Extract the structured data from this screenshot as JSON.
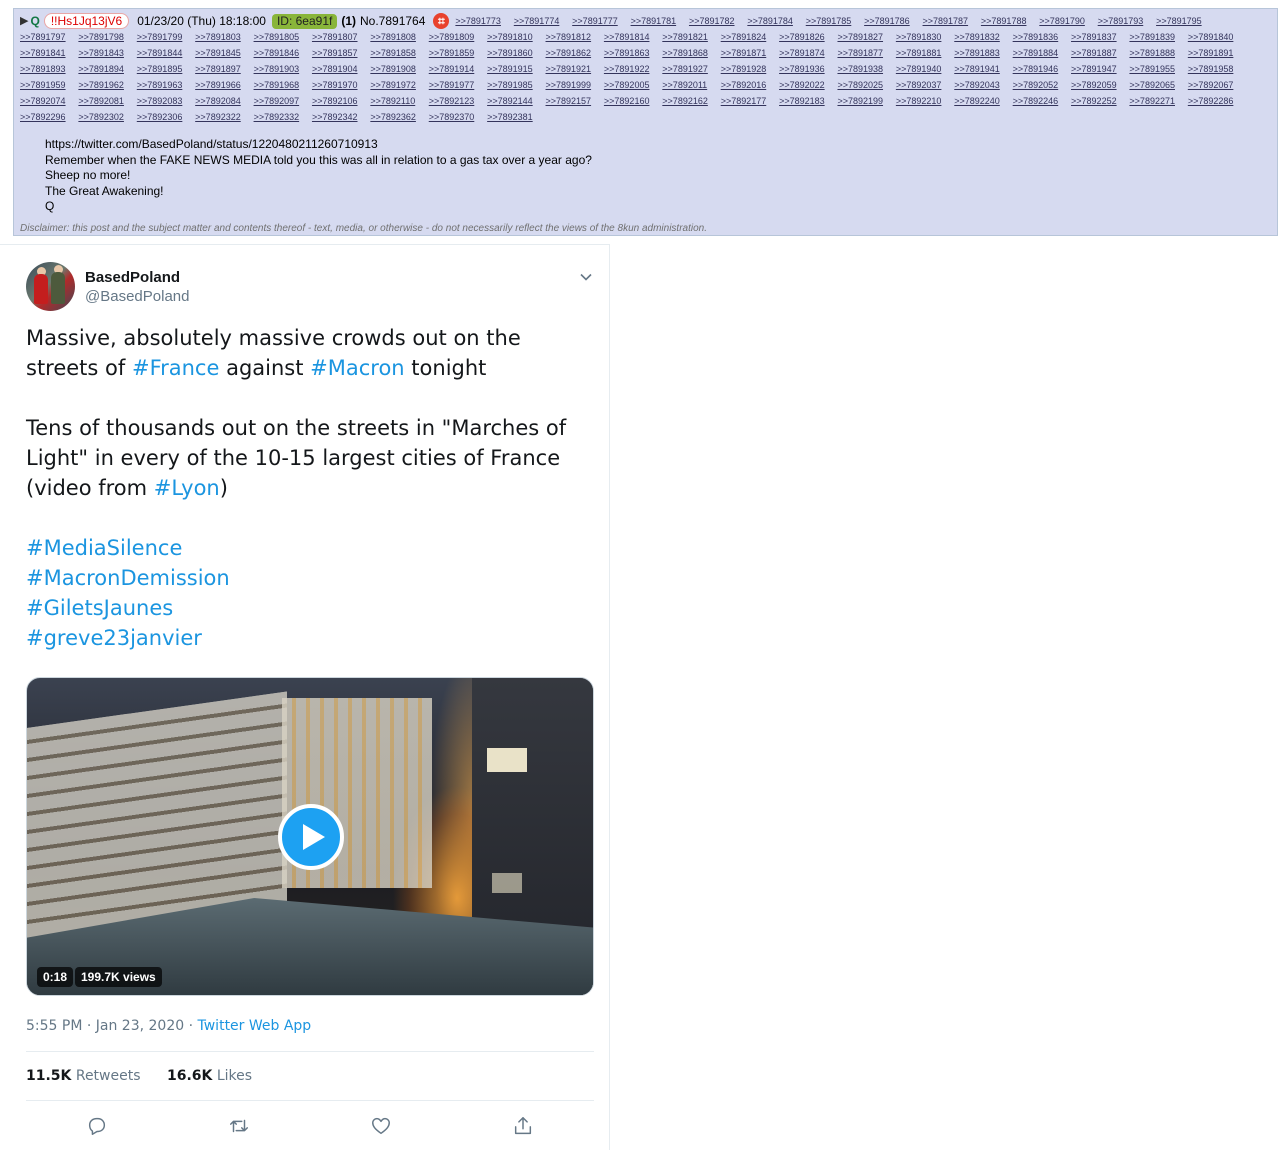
{
  "post": {
    "arrow": "▶",
    "name": "Q",
    "trip": "!!Hs1Jq13jV6",
    "date": "01/23/20 (Thu) 18:18:00",
    "id_label": "ID: 6ea91f",
    "count": "(1)",
    "number": "No.7891764",
    "flag_glyph": "⌗",
    "backlinks": [
      ">>7891773",
      ">>7891774",
      ">>7891777",
      ">>7891781",
      ">>7891782",
      ">>7891784",
      ">>7891785",
      ">>7891786",
      ">>7891787",
      ">>7891788",
      ">>7891790",
      ">>7891793",
      ">>7891795",
      ">>7891797",
      ">>7891798",
      ">>7891799",
      ">>7891803",
      ">>7891805",
      ">>7891807",
      ">>7891808",
      ">>7891809",
      ">>7891810",
      ">>7891812",
      ">>7891814",
      ">>7891821",
      ">>7891824",
      ">>7891826",
      ">>7891827",
      ">>7891830",
      ">>7891832",
      ">>7891836",
      ">>7891837",
      ">>7891839",
      ">>7891840",
      ">>7891841",
      ">>7891843",
      ">>7891844",
      ">>7891845",
      ">>7891846",
      ">>7891857",
      ">>7891858",
      ">>7891859",
      ">>7891860",
      ">>7891862",
      ">>7891863",
      ">>7891868",
      ">>7891871",
      ">>7891874",
      ">>7891877",
      ">>7891881",
      ">>7891883",
      ">>7891884",
      ">>7891887",
      ">>7891888",
      ">>7891891",
      ">>7891893",
      ">>7891894",
      ">>7891895",
      ">>7891897",
      ">>7891903",
      ">>7891904",
      ">>7891908",
      ">>7891914",
      ">>7891915",
      ">>7891921",
      ">>7891922",
      ">>7891927",
      ">>7891928",
      ">>7891936",
      ">>7891938",
      ">>7891940",
      ">>7891941",
      ">>7891946",
      ">>7891947",
      ">>7891955",
      ">>7891958",
      ">>7891959",
      ">>7891962",
      ">>7891963",
      ">>7891966",
      ">>7891968",
      ">>7891970",
      ">>7891972",
      ">>7891977",
      ">>7891985",
      ">>7891999",
      ">>7892005",
      ">>7892011",
      ">>7892016",
      ">>7892022",
      ">>7892025",
      ">>7892037",
      ">>7892043",
      ">>7892052",
      ">>7892059",
      ">>7892065",
      ">>7892067",
      ">>7892074",
      ">>7892081",
      ">>7892083",
      ">>7892084",
      ">>7892097",
      ">>7892106",
      ">>7892110",
      ">>7892123",
      ">>7892144",
      ">>7892157",
      ">>7892160",
      ">>7892162",
      ">>7892177",
      ">>7892183",
      ">>7892199",
      ">>7892210",
      ">>7892240",
      ">>7892246",
      ">>7892252",
      ">>7892271",
      ">>7892286",
      ">>7892296",
      ">>7892302",
      ">>7892306",
      ">>7892322",
      ">>7892332",
      ">>7892342",
      ">>7892362",
      ">>7892370",
      ">>7892381"
    ],
    "body_link": "https://twitter.com/BasedPoland/status/1220480211260710913",
    "body_lines": [
      "Remember when the FAKE NEWS MEDIA told you this was all in relation to a gas tax over a year ago?",
      "Sheep no more!",
      "The Great Awakening!",
      "Q"
    ],
    "disclaimer": "Disclaimer: this post and the subject matter and contents thereof - text, media, or otherwise - do not necessarily reflect the views of the 8kun administration."
  },
  "tweet": {
    "display_name": "BasedPoland",
    "handle": "@BasedPoland",
    "p1": {
      "a": "Massive, absolutely massive crowds out on the streets of ",
      "h1": "#France",
      "b": " against ",
      "h2": "#Macron",
      "c": " tonight"
    },
    "p2": {
      "a": "Tens of thousands out on the streets in \"Marches of Light\" in every of the 10-15 largest cities of France (video from ",
      "h1": "#Lyon",
      "b": ")"
    },
    "hashtags": [
      "#MediaSilence",
      "#MacronDemission",
      "#GiletsJaunes",
      "#greve23janvier"
    ],
    "video_duration": "0:18",
    "video_views": "199.7K views",
    "time": "5:55 PM · Jan 23, 2020 · ",
    "app": "Twitter Web App",
    "retweets_count": "11.5K",
    "retweets_label": "Retweets",
    "likes_count": "16.6K",
    "likes_label": "Likes",
    "icons": [
      "reply-icon",
      "retweet-icon",
      "like-icon",
      "share-icon"
    ]
  },
  "colors": {
    "post_bg": "#d6daf0",
    "name": "#117743",
    "trip": "#dd0000",
    "id_bg": "#89b53a",
    "link": "#34345c",
    "hashtag": "#1b95e0",
    "play": "#1da1f2"
  }
}
